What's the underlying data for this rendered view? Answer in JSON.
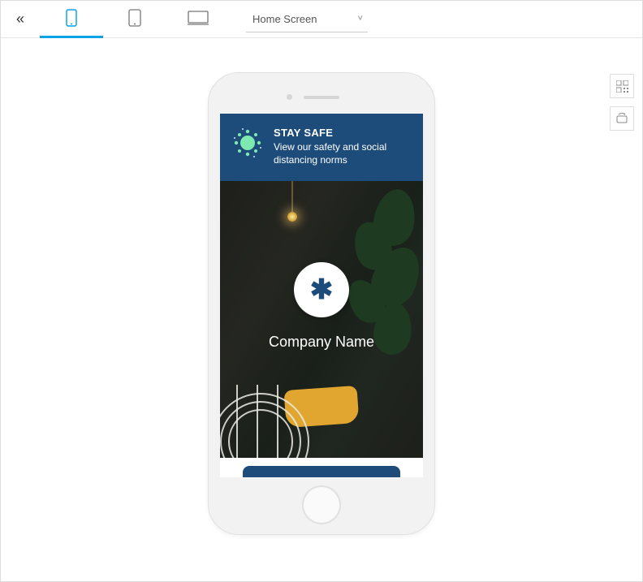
{
  "toolbar": {
    "collapse_icon": "«",
    "device_tabs": {
      "phone": "phone",
      "tablet": "tablet",
      "desktop": "desktop"
    },
    "active_device": "phone",
    "screen_select": {
      "label": "Home Screen",
      "chevron": "˅"
    }
  },
  "side_tools": {
    "qr": "qr-icon",
    "rotate": "rotate-icon"
  },
  "app": {
    "banner": {
      "heading": "STAY SAFE",
      "body": "View our safety and social distancing norms",
      "icon_name": "virus-icon"
    },
    "hero": {
      "logo_glyph": "✱",
      "company_label": "Company Name"
    },
    "cta": {
      "visible_bar": true
    }
  },
  "colors": {
    "accent": "#0aa3e8",
    "brand_blue": "#1e4c7a",
    "virus_green": "#7de8b0"
  }
}
